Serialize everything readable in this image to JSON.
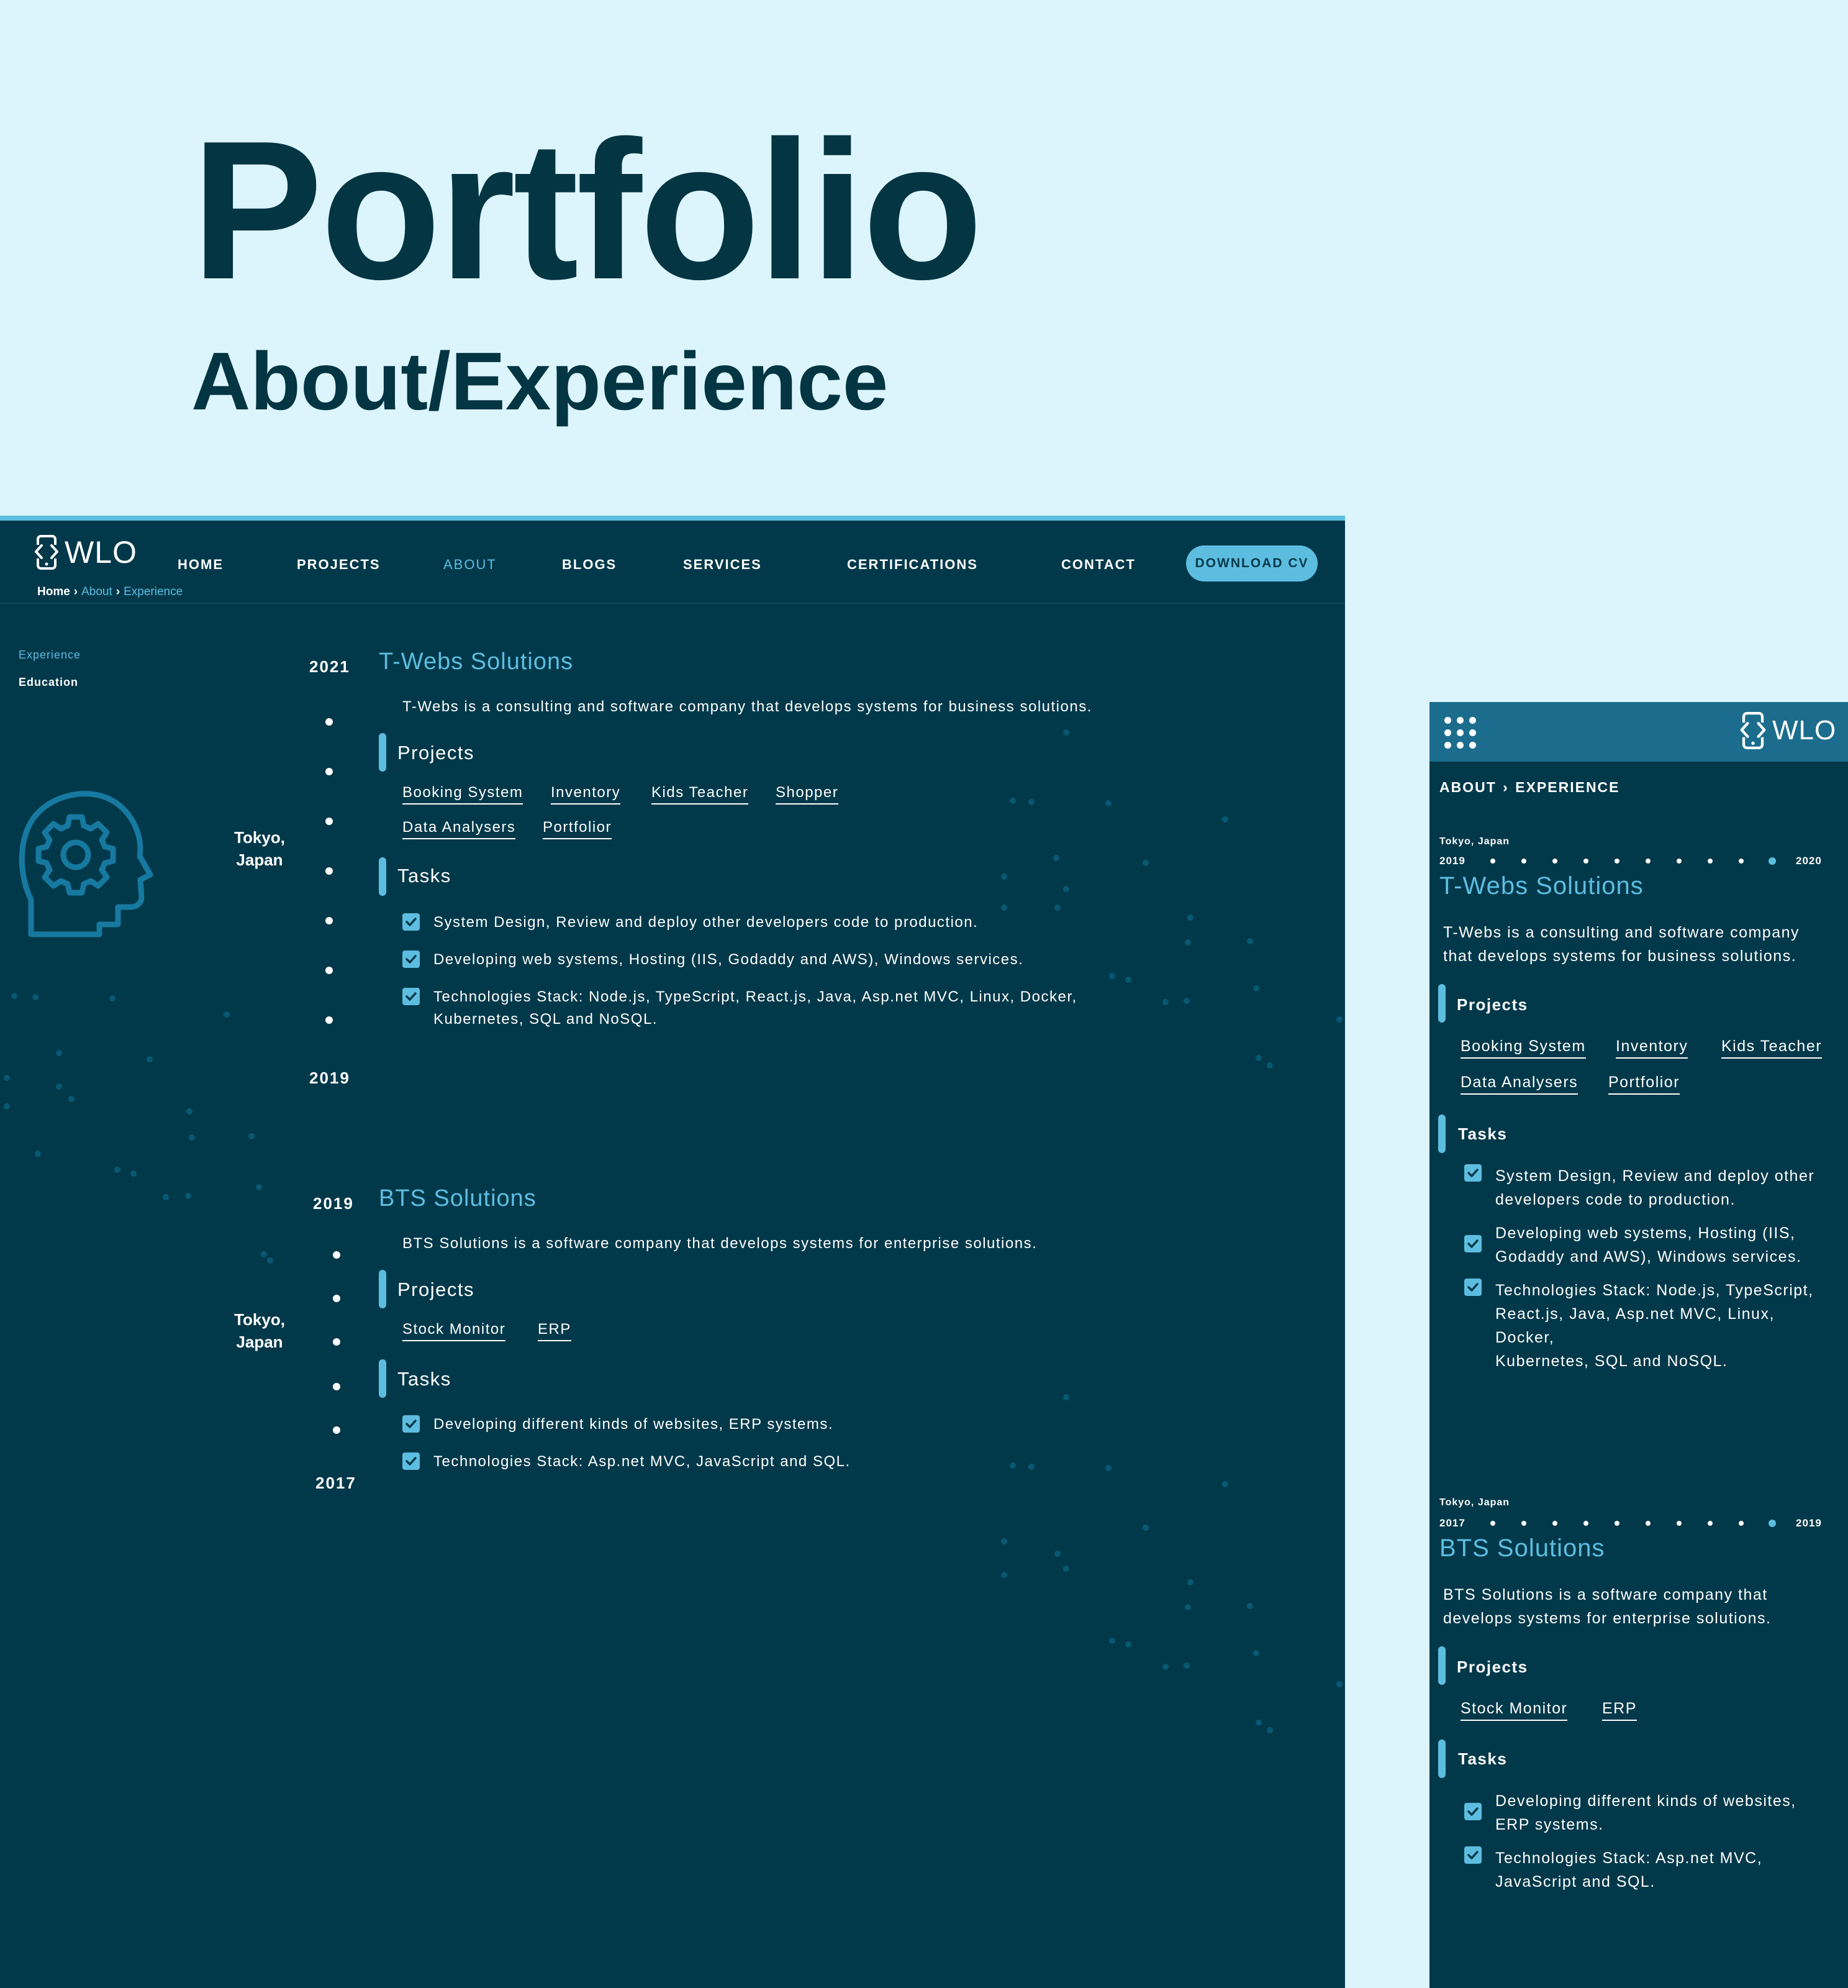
{
  "hero": {
    "title": "Portfolio",
    "subtitle": "About/Experience"
  },
  "colors": {
    "background": "#dcf5fc",
    "panel": "#02394a",
    "accent": "#5dbde0",
    "mobile_bar": "#1c6d8d",
    "heading": "#043542"
  },
  "desktop": {
    "logo_text": "WLO",
    "nav": [
      "HOME",
      "PROJECTS",
      "ABOUT",
      "BLOGS",
      "SERVICES",
      "CERTIFICATIONS",
      "CONTACT"
    ],
    "active_nav": "ABOUT",
    "download_cv": "DOWNLOAD CV",
    "breadcrumb": {
      "home": "Home",
      "about": "About",
      "current": "Experience"
    },
    "side_menu": {
      "experience": "Experience",
      "education": "Education"
    },
    "experiences": [
      {
        "start_year": "2021",
        "end_year": "2019",
        "location": "Tokyo, Japan",
        "company": "T-Webs Solutions",
        "description": "T-Webs is a consulting and software company that develops systems for business solutions.",
        "projects_heading": "Projects",
        "projects": [
          "Booking System",
          "Inventory",
          "Kids Teacher",
          "Shopper",
          "Data Analysers",
          "Portfolior"
        ],
        "tasks_heading": "Tasks",
        "tasks": [
          "System Design, Review and deploy other developers code to production.",
          "Developing web systems, Hosting (IIS, Godaddy and AWS), Windows services.",
          "Technologies Stack: Node.js, TypeScript, React.js, Java, Asp.net MVC, Linux, Docker,",
          "Kubernetes, SQL and NoSQL."
        ]
      },
      {
        "start_year": "2019",
        "end_year": "2017",
        "location": "Tokyo, Japan",
        "company": "BTS Solutions",
        "description": "BTS Solutions  is a software company that develops systems for enterprise solutions.",
        "projects_heading": "Projects",
        "projects": [
          "Stock Monitor",
          "ERP"
        ],
        "tasks_heading": "Tasks",
        "tasks": [
          "Developing different kinds of websites, ERP systems.",
          "Technologies Stack: Asp.net MVC, JavaScript and SQL."
        ]
      }
    ]
  },
  "mobile": {
    "logo_text": "WLO",
    "breadcrumb": {
      "parent": "ABOUT",
      "current": "EXPERIENCE"
    },
    "experiences": [
      {
        "location": "Tokyo, Japan",
        "year_from": "2019",
        "year_to": "2020",
        "company": "T-Webs Solutions",
        "description": "T-Webs is a consulting and software company that develops systems for business solutions.",
        "projects_heading": "Projects",
        "projects": [
          "Booking System",
          "Inventory",
          "Kids Teacher",
          "Data Analysers",
          "Portfolior"
        ],
        "tasks_heading": "Tasks",
        "tasks": [
          "System Design, Review and deploy other developers code to production.",
          "Developing web systems, Hosting (IIS, Godaddy and AWS), Windows services.",
          "Technologies Stack: Node.js, TypeScript, React.js, Java, Asp.net MVC, Linux, Docker,\nKubernetes, SQL and NoSQL."
        ]
      },
      {
        "location": "Tokyo, Japan",
        "year_from": "2017",
        "year_to": "2019",
        "company": "BTS Solutions",
        "description": "BTS Solutions  is a software company that develops systems for enterprise solutions.",
        "projects_heading": "Projects",
        "projects": [
          "Stock Monitor",
          "ERP"
        ],
        "tasks_heading": "Tasks",
        "tasks": [
          "Developing different kinds of websites, ERP systems.",
          "Technologies Stack: Asp.net MVC, JavaScript and SQL."
        ]
      }
    ]
  }
}
